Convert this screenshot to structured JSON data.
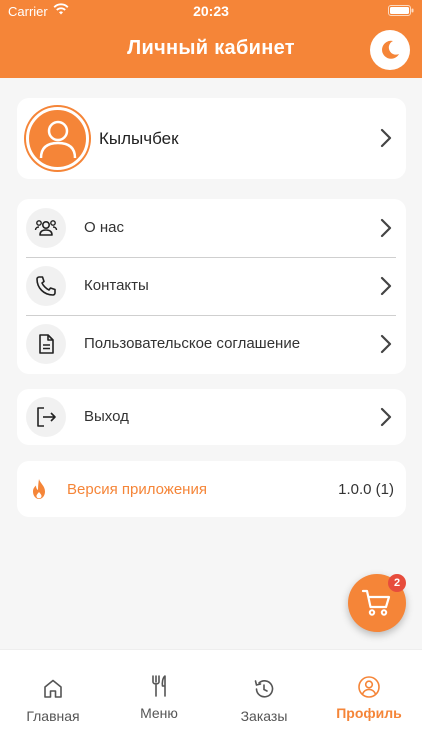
{
  "status_bar": {
    "carrier": "Carrier",
    "time": "20:23"
  },
  "header": {
    "title": "Личный кабинет"
  },
  "profile": {
    "name": "Кылычбек"
  },
  "menu": {
    "items": [
      {
        "label": "О нас",
        "icon": "people-icon"
      },
      {
        "label": "Контакты",
        "icon": "phone-icon"
      },
      {
        "label": "Пользовательское соглашение",
        "icon": "document-icon"
      }
    ]
  },
  "logout": {
    "label": "Выход",
    "icon": "logout-icon"
  },
  "version": {
    "label": "Версия приложения",
    "value": "1.0.0 (1)"
  },
  "cart": {
    "badge": "2"
  },
  "tabs": [
    {
      "label": "Главная",
      "icon": "home-icon"
    },
    {
      "label": "Меню",
      "icon": "fork-knife-icon"
    },
    {
      "label": "Заказы",
      "icon": "history-icon"
    },
    {
      "label": "Профиль",
      "icon": "profile-icon",
      "active": true
    }
  ],
  "colors": {
    "accent": "#f58538",
    "badge": "#e74c3c",
    "background": "#f6f6f6"
  }
}
